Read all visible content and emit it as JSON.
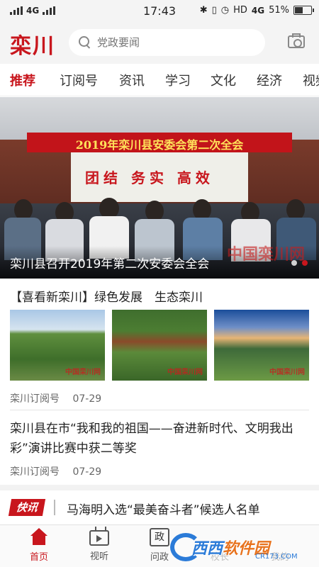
{
  "status_bar": {
    "network": "4G",
    "time": "17:43",
    "hd": "HD",
    "network2": "4G",
    "battery_percent": "51%",
    "battery_level": 0.51
  },
  "header": {
    "logo": "栾川",
    "search_placeholder": "党政要闻"
  },
  "tabs": [
    "推荐",
    "订阅号",
    "资讯",
    "学习",
    "文化",
    "经济",
    "视频"
  ],
  "active_tab": 0,
  "banner": {
    "banner_text": "2019年栾川县安委会第二次全会",
    "screen_text": "团结 务实 高效",
    "caption": "栾川县召开2019年第二次安委会全会",
    "watermark": "中国栾川网",
    "slide_count": 2,
    "active_slide": 1
  },
  "articles": [
    {
      "title": "【喜看新栾川】绿色发展　生态栾川",
      "thumb_marks": [
        "中国栾川网",
        "中国栾川网",
        "中国栾川网"
      ],
      "source": "栾川订阅号",
      "date": "07-29"
    },
    {
      "title": "栾川县在市“我和我的祖国——奋进新时代、文明我出彩”演讲比赛中获二等奖",
      "source": "栾川订阅号",
      "date": "07-29"
    }
  ],
  "flash": {
    "badge": "快讯",
    "text": "马海明入选“最美奋斗者”候选人名单"
  },
  "bottom_nav": [
    {
      "label": "首页",
      "icon": "home-icon"
    },
    {
      "label": "视听",
      "icon": "tv-icon"
    },
    {
      "label": "问政",
      "icon": "zheng-icon",
      "glyph": "政"
    },
    {
      "label": "校长",
      "icon": "unknown-icon"
    },
    {
      "label": "我的",
      "icon": "person-icon"
    }
  ],
  "watermark_logo": {
    "text_a": "西西",
    "text_b": "软件园",
    "sub": "CR173.COM"
  },
  "colors": {
    "accent": "#c8161d",
    "banner_red": "#c2141a"
  }
}
